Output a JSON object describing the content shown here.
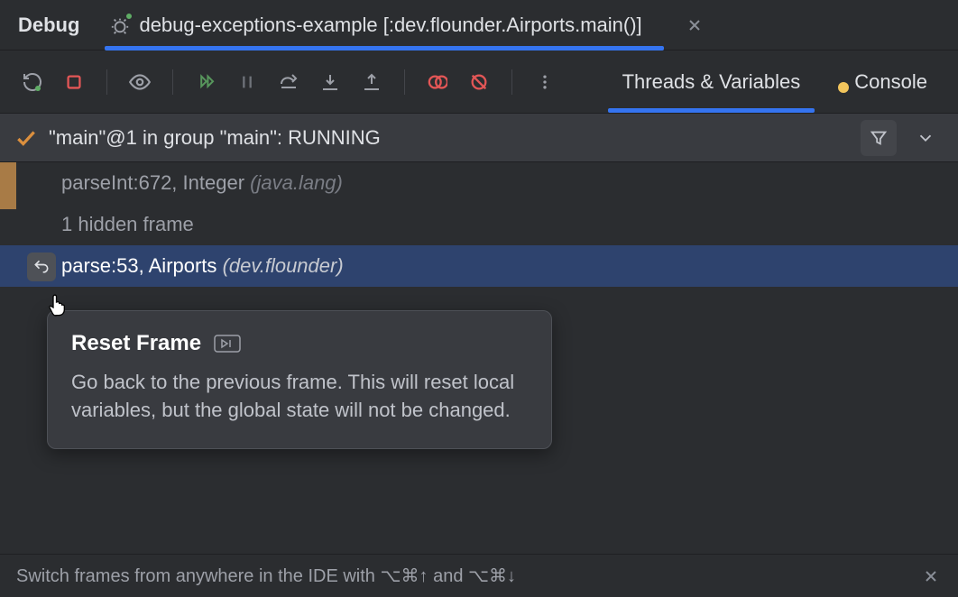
{
  "header": {
    "debug_label": "Debug",
    "run_config_name": "debug-exceptions-example [:dev.flounder.Airports.main()]"
  },
  "subtabs": {
    "threads": "Threads & Variables",
    "console": "Console"
  },
  "thread_status": "\"main\"@1 in group \"main\": RUNNING",
  "frames": [
    {
      "method": "parseInt:672, Integer",
      "pkg": "(java.lang)",
      "selected": false
    },
    {
      "method": "1 hidden frame",
      "pkg": "",
      "selected": false
    },
    {
      "method": "parse:53, Airports",
      "pkg": "(dev.flounder)",
      "selected": true
    }
  ],
  "tooltip": {
    "title": "Reset Frame",
    "body": "Go back to the previous frame. This will reset local variables, but the global state will not be changed."
  },
  "hint": "Switch frames from anywhere in the IDE with ⌥⌘↑ and ⌥⌘↓"
}
